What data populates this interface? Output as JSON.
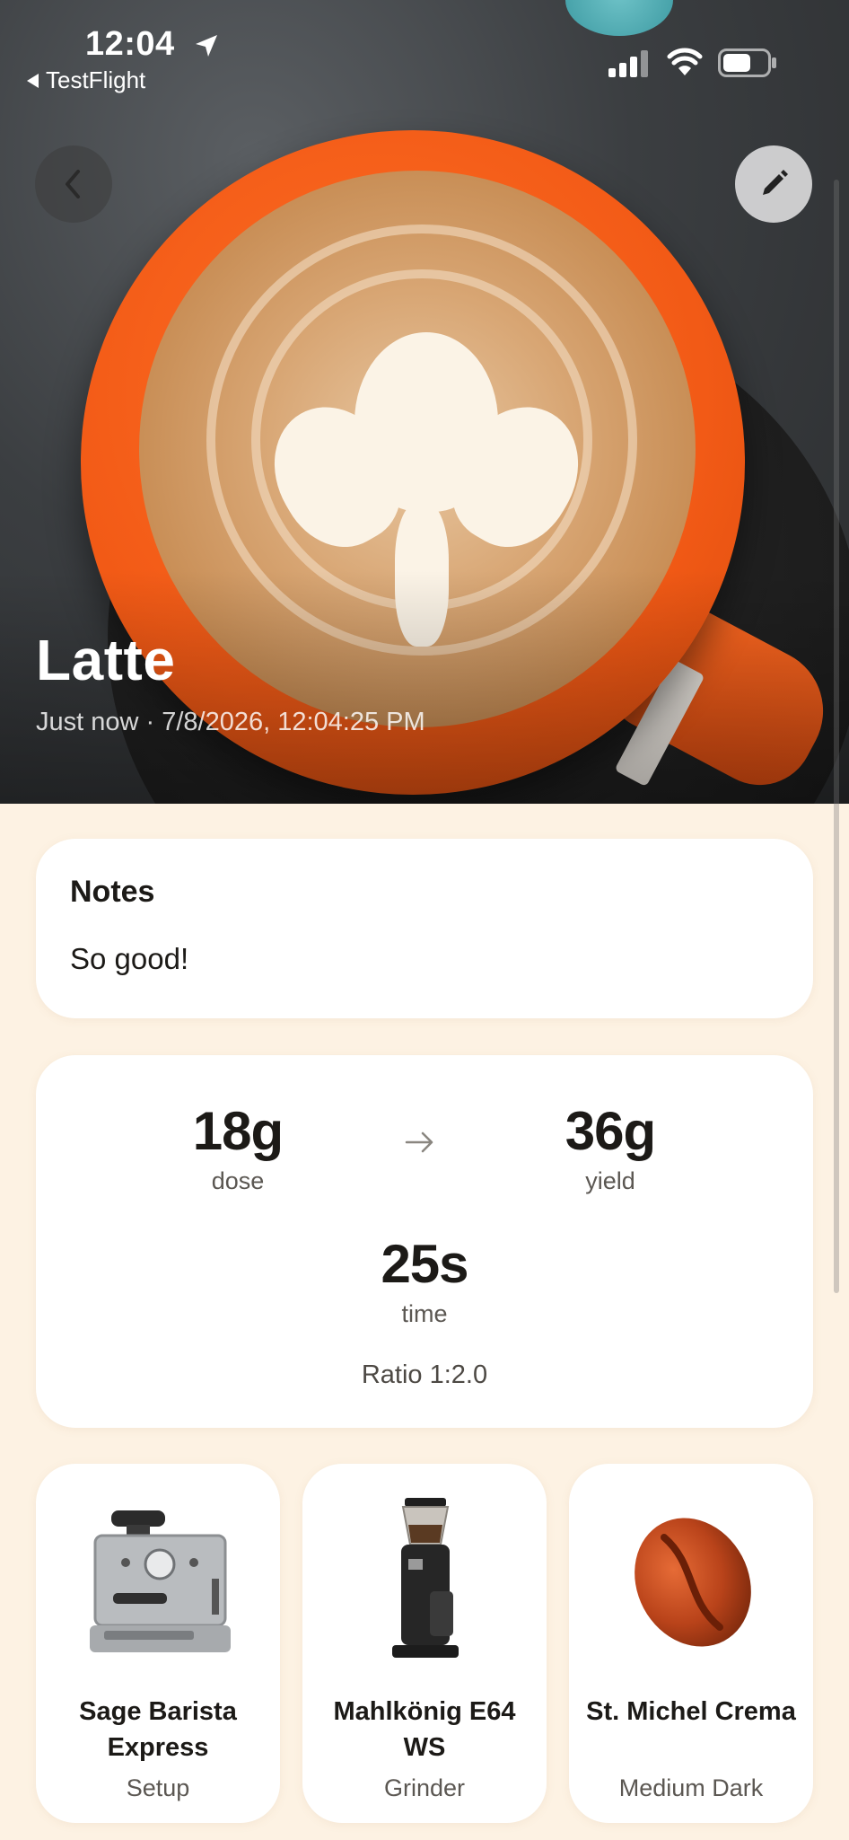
{
  "status_bar": {
    "time": "12:04",
    "back_app": "TestFlight"
  },
  "hero": {
    "title": "Latte",
    "subtitle": "Just now · 7/8/2026, 12:04:25 PM"
  },
  "notes": {
    "heading": "Notes",
    "text": "So good!"
  },
  "stats": {
    "dose_value": "18g",
    "dose_label": "dose",
    "yield_value": "36g",
    "yield_label": "yield",
    "time_value": "25s",
    "time_label": "time",
    "ratio": "Ratio 1:2.0"
  },
  "equipment": [
    {
      "name": "Sage Barista Express",
      "type": "Setup",
      "icon": "espresso-machine-icon"
    },
    {
      "name": "Mahlkönig E64 WS",
      "type": "Grinder",
      "icon": "grinder-icon"
    },
    {
      "name": "St. Michel Crema",
      "type": "Medium Dark",
      "icon": "coffee-bean-icon"
    }
  ],
  "colors": {
    "background": "#fdf2e3",
    "card": "#ffffff",
    "cup": "#f25a16"
  }
}
